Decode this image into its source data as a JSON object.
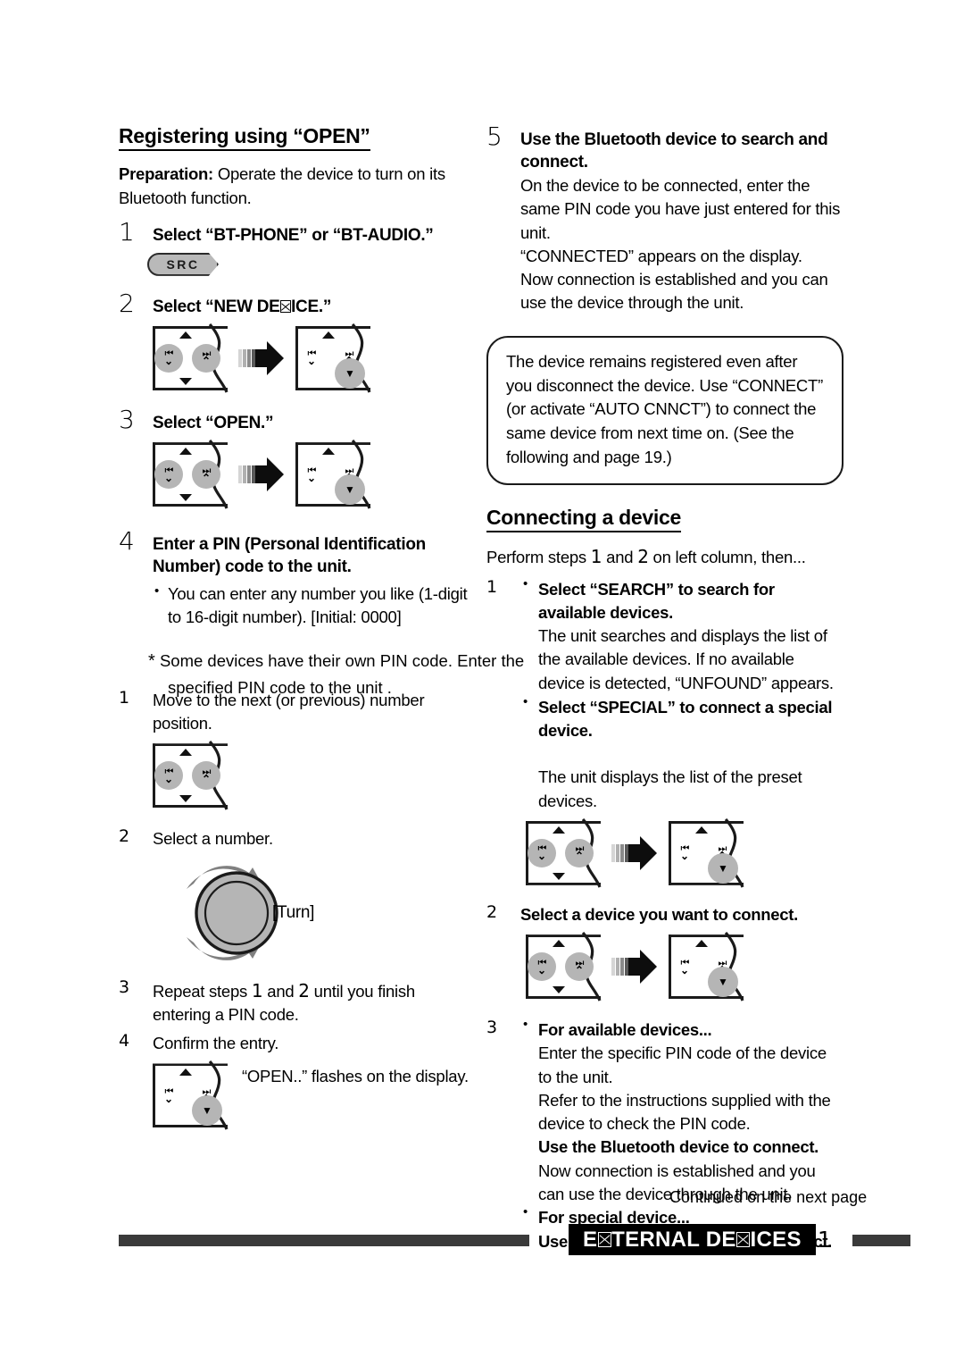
{
  "page": {
    "footer": {
      "continued_note": "Continued on the next page",
      "tag_prefix": "E",
      "tag_mid": "TERNAL DE",
      "tag_suffix": "ICES",
      "tag_full_text": "EXTERNAL DEVICES",
      "page_number": "11"
    }
  },
  "left_column": {
    "section_title": "Registering using “OPEN”",
    "preparation_label": "Preparation:",
    "preparation_text": " Operate the device to turn on its Bluetooth function.",
    "step1": {
      "num": "1",
      "title": "Select “BT-PHONE” or “BT-AUDIO.”",
      "button_label": "SRC"
    },
    "step2": {
      "num": "2",
      "title_pre": "Select “NEW DE",
      "title_post": "ICE.”",
      "title_full": "Select “NEW DEVICE.”"
    },
    "step3": {
      "num": "3",
      "title": "Select “OPEN.”"
    },
    "step4": {
      "num": "4",
      "title": "Enter a PIN (Personal Identification Number) code to the unit.",
      "bullet1": "You can enter any number you like (1-digit to 16-digit number). [Initial: 0000]",
      "asterisk_note_line1": "Some   devices  have   their   own  PIN  code.   Enter   the",
      "asterisk_note_line2": "specified  PIN  code   to the   unit .",
      "asterisk_note_clean": "Some devices have their own PIN code. Enter the specified PIN code to the unit.",
      "sub1": {
        "num": "1",
        "text": "Move to the next (or previous) number position."
      },
      "sub2": {
        "num": "2",
        "text": "Select a number.",
        "knob_label": "[Turn]"
      },
      "sub3": {
        "num": "3",
        "text_a": "Repeat steps ",
        "step_a": "1",
        "text_b": " and ",
        "step_b": "2",
        "text_c": " until you finish entering a PIN code."
      },
      "sub4": {
        "num": "4",
        "text": "Confirm the entry.",
        "display_note": "“OPEN..” flashes on the display."
      }
    }
  },
  "right_column": {
    "step5": {
      "num": "5",
      "title": "Use the Bluetooth device to search and connect.",
      "body": "On the device to be connected, enter the same PIN code you have just entered for this unit.\n“CONNECTED” appears on the display.\nNow connection is established and you can use the device through the unit."
    },
    "note_box": "The device remains registered even after you disconnect the device. Use “CONNECT” (or activate “AUTO CNNCT”) to connect the same device from next time on. (See the following and page 19.)",
    "section_title": "Connecting a device",
    "intro_a": "Perform steps ",
    "intro_step1": "1",
    "intro_b": " and ",
    "intro_step2": "2",
    "intro_c": " on left column, then...",
    "step1": {
      "num": "1",
      "bullet1_title": "Select “SEARCH” to search for available devices.",
      "bullet1_body": "The unit searches and displays the list of the available devices. If no available device is detected, “UNFOUND” appears.",
      "bullet2_title": "Select “SPECIAL” to connect a special device.",
      "bullet2_body": "The unit displays the list of the preset devices."
    },
    "step2": {
      "num": "2",
      "title": "Select a device you want to connect."
    },
    "step3": {
      "num": "3",
      "bullet1_title": "For available devices...",
      "bullet1_body": "Enter the specific PIN code of the device to the unit.\nRefer to the instructions supplied with the device to check the PIN code.",
      "bullet1_bold": "Use the Bluetooth device to connect.",
      "bullet1_tail": "Now connection is established and you can use the device through the unit.",
      "bullet2_title": "For special device...",
      "bullet2_bold": "Use “OPEN” or “SEARCH” to connect."
    }
  },
  "icons": {
    "panel_name": "control-panel-pictogram",
    "arrow_name": "striped-right-arrow-icon",
    "knob_name": "rotary-knob-icon",
    "skip_back_glyph": "⏮",
    "skip_fwd_glyph": "⏭",
    "chevron_down": "⌄",
    "chevron_up": "⌃"
  },
  "colors": {
    "ink": "#000000",
    "panel_shade": "#b5b5b5",
    "rule_gray": "#3a3a3a",
    "src_fill": "#b9b9b9"
  }
}
